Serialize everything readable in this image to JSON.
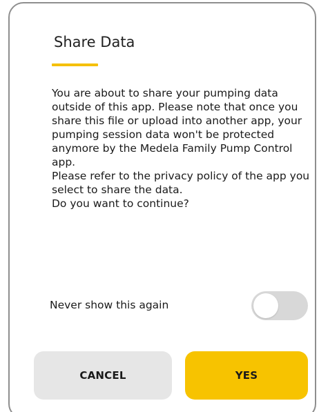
{
  "dialog": {
    "title": "Share Data",
    "message": [
      "You are about to share your pumping data outside of this app. Please note that once you share this file or upload into another app, your pumping session data won't be protected anymore by the Medela Family Pump Control app.",
      "Please refer to the privacy policy of the app you select to share the data.",
      "Do you want to continue?"
    ],
    "never_show_label": "Never show this again",
    "never_show_toggle": {
      "state": "off"
    },
    "cancel_label": "CANCEL",
    "yes_label": "YES"
  },
  "colors": {
    "accent": "#f5c000",
    "primary_button": "#f7c300",
    "secondary_button": "#e6e6e6",
    "toggle_off_track": "#d8d8d8",
    "border": "#8e8e8e"
  }
}
